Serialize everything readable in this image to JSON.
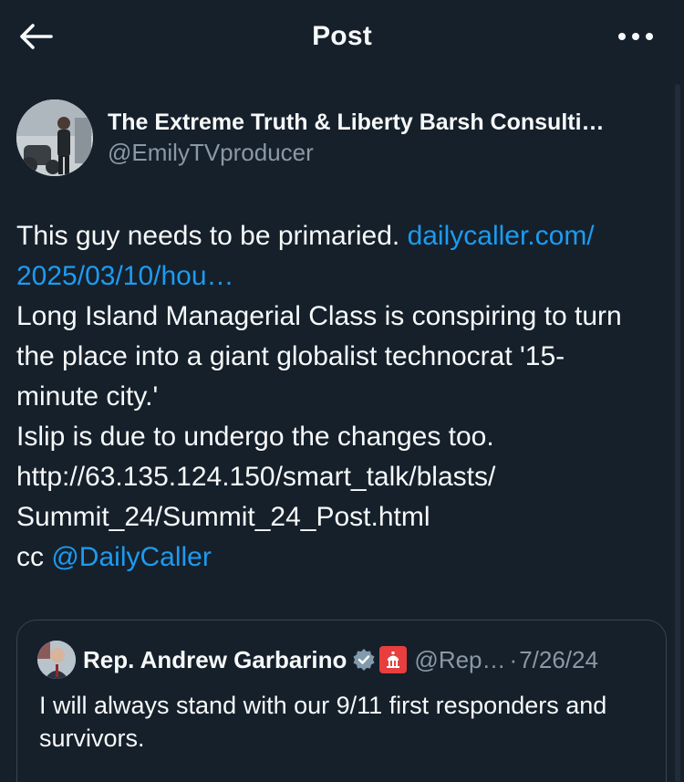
{
  "header": {
    "title": "Post",
    "back_icon": "arrow-left-icon",
    "more_icon": "more-horizontal-icon"
  },
  "author": {
    "display_name": "The Extreme Truth & Liberty Barsh Consulti…",
    "handle": "@EmilyTVproducer"
  },
  "post": {
    "line1_text": "This guy needs to be primaried.  ",
    "link_part1": "dailycaller.com/",
    "link_part2": "2025/03/10/hou…",
    "line3": "Long Island Managerial Class is conspiring to turn",
    "line4": "the place into a giant globalist technocrat '15-",
    "line5": "minute city.'",
    "line6": "Islip is due to undergo the changes too.",
    "line7": "http://63.135.124.150/smart_talk/blasts/",
    "line8": "Summit_24/Summit_24_Post.html",
    "cc_prefix": "cc ",
    "mention": "@DailyCaller"
  },
  "quote": {
    "name": "Rep. Andrew Garbarino",
    "handle": "@Rep…",
    "separator": "·",
    "date": "7/26/24",
    "text": "I will always stand with our 9/11 first responders and survivors."
  },
  "colors": {
    "background": "#15202b",
    "link": "#1d9bf0",
    "secondary_text": "#8b98a5",
    "border": "#38444d"
  }
}
